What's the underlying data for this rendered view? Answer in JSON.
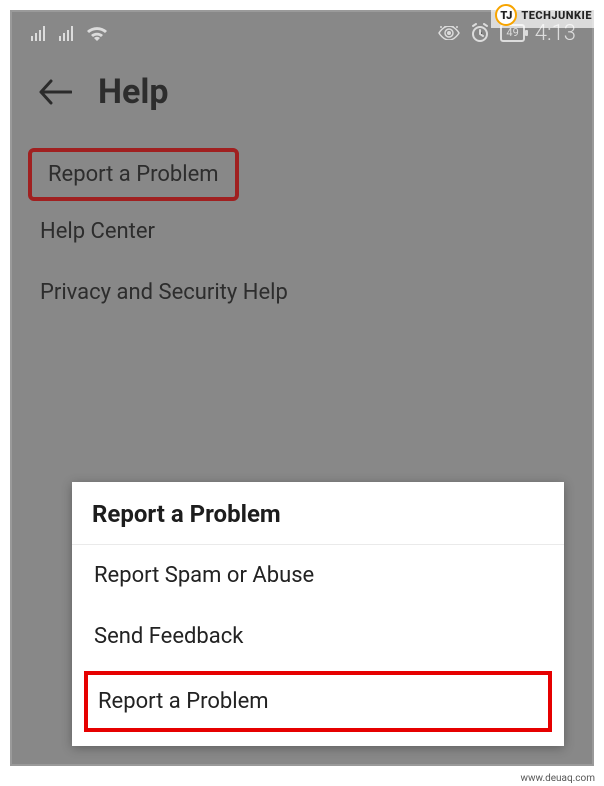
{
  "status_bar": {
    "battery_level": "49",
    "time": "4:13"
  },
  "header": {
    "title": "Help"
  },
  "menu": {
    "items": [
      {
        "label": "Report a Problem"
      },
      {
        "label": "Help Center"
      },
      {
        "label": "Privacy and Security Help"
      }
    ]
  },
  "dialog": {
    "title": "Report a Problem",
    "items": [
      {
        "label": "Report Spam or Abuse"
      },
      {
        "label": "Send Feedback"
      },
      {
        "label": "Report a Problem"
      }
    ]
  },
  "branding": {
    "logo_badge": "TJ",
    "logo_text": "TECHJUNKIE",
    "watermark": "www.deuaq.com"
  }
}
